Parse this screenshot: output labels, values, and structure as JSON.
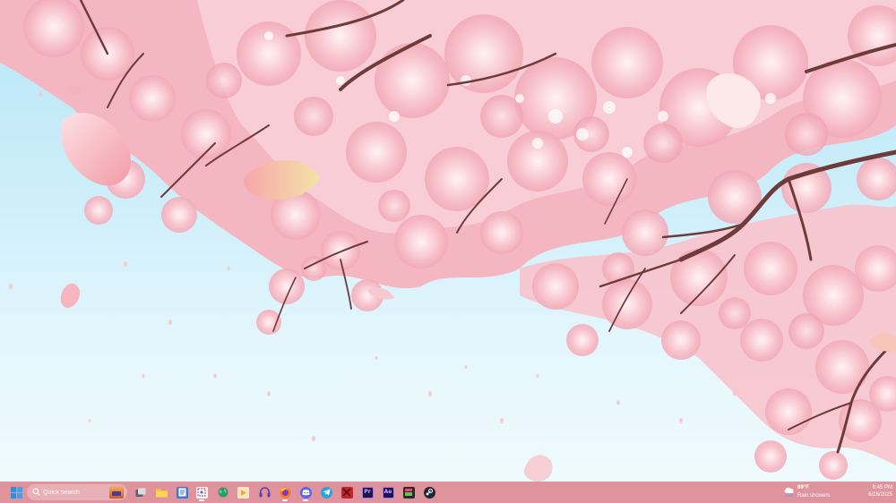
{
  "desktop": {
    "wallpaper": "cherry-blossom-branches",
    "colors": {
      "sky": "#cdeefa",
      "blossom": "#f6b9c3",
      "branch": "#6e3b3b",
      "taskbar": "#e08c96"
    }
  },
  "taskbar": {
    "start_icon": "windows-logo-icon",
    "search": {
      "placeholder": "Quick search"
    },
    "apps": [
      {
        "name": "task-view",
        "icon": "task-view-icon",
        "color": "#8e9aa8"
      },
      {
        "name": "file-explorer",
        "icon": "folder-icon",
        "color": "#f4c03a"
      },
      {
        "name": "notepad",
        "icon": "notepad-icon",
        "color": "#3a7bd5"
      },
      {
        "name": "snipping-tool",
        "icon": "snipping-tool-icon",
        "color": "#ffffff"
      },
      {
        "name": "browser-globe",
        "icon": "globe-icon",
        "color": "#2d9a6a"
      },
      {
        "name": "media-player",
        "icon": "play-icon",
        "color": "#f2a93b"
      },
      {
        "name": "headphones-app",
        "icon": "headphones-icon",
        "color": "#5b3fb0"
      },
      {
        "name": "firefox",
        "icon": "firefox-icon",
        "color": "#ff7a1a"
      },
      {
        "name": "discord",
        "icon": "discord-icon",
        "color": "#5865f2"
      },
      {
        "name": "telegram",
        "icon": "telegram-icon",
        "color": "#2aa3de"
      },
      {
        "name": "app-red",
        "icon": "red-app-icon",
        "color": "#c4242a"
      },
      {
        "name": "premiere-pro",
        "icon": "premiere-pro-icon",
        "label": "Pr",
        "color": "#1f1250"
      },
      {
        "name": "after-effects",
        "icon": "after-effects-icon",
        "label": "Ae",
        "color": "#1f1250"
      },
      {
        "name": "media-app",
        "icon": "media-app-icon",
        "color": "#2b2b2b"
      },
      {
        "name": "steam",
        "icon": "steam-icon",
        "color": "#1b2838"
      }
    ],
    "weather": {
      "temperature": "89°F",
      "condition": "Rain showers",
      "icon": "rain-cloud-icon"
    },
    "clock": {
      "time": "6:45 PM",
      "date": "6/26/2025"
    }
  }
}
